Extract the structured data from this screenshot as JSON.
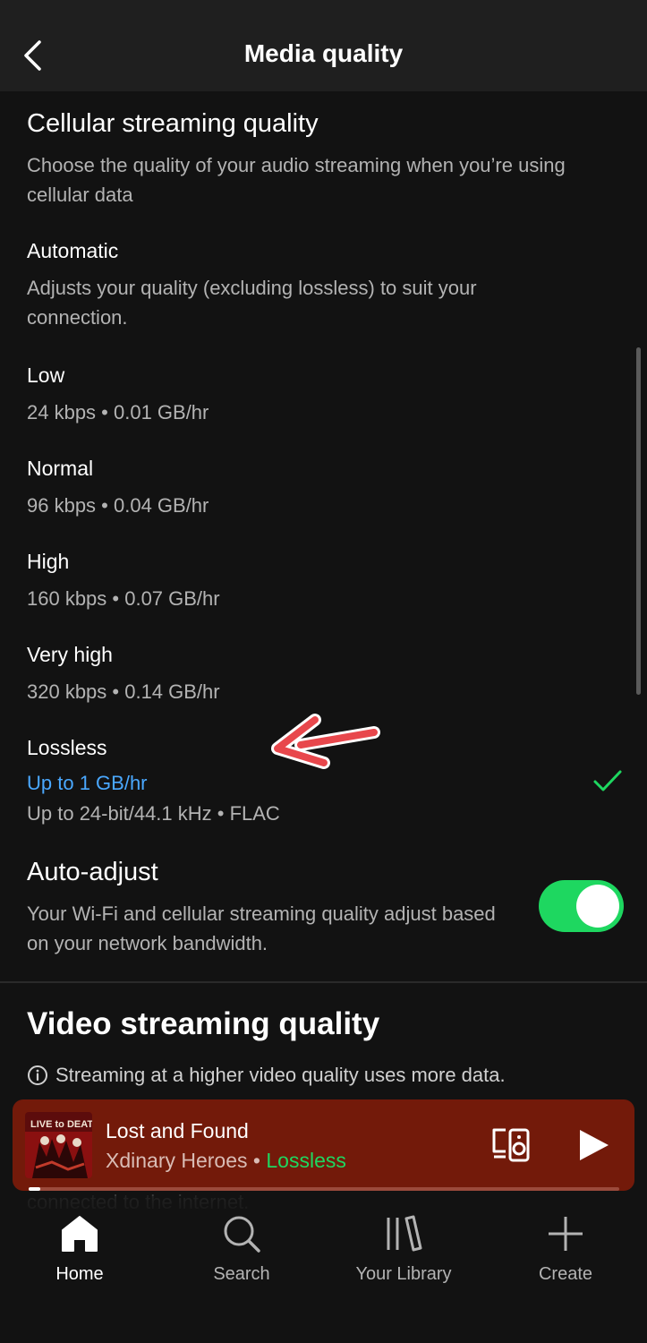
{
  "header": {
    "title": "Media quality"
  },
  "cellular": {
    "title": "Cellular streaming quality",
    "description": "Choose the quality of your audio streaming when you’re using cellular data"
  },
  "options": [
    {
      "label": "Automatic",
      "description": "Adjusts your quality (excluding lossless) to suit your connection."
    },
    {
      "label": "Low",
      "detail": "24 kbps • 0.01 GB/hr"
    },
    {
      "label": "Normal",
      "detail": "96 kbps • 0.04 GB/hr"
    },
    {
      "label": "High",
      "detail": "160 kbps • 0.07 GB/hr"
    },
    {
      "label": "Very high",
      "detail": "320 kbps • 0.14 GB/hr"
    },
    {
      "label": "Lossless",
      "accent": "Up to 1 GB/hr",
      "detail": "Up to 24-bit/44.1 kHz • FLAC",
      "selected": true
    }
  ],
  "auto_adjust": {
    "title": "Auto-adjust",
    "description": "Your Wi-Fi and cellular streaming quality adjust based on your network bandwidth.",
    "enabled": true
  },
  "video": {
    "title": "Video streaming quality",
    "info": "Streaming at a higher video quality uses more data.",
    "partial_text": "connected to the internet."
  },
  "player": {
    "title": "Lost and Found",
    "artist": "Xdinary Heroes",
    "separator": "•",
    "quality": "Lossless",
    "progress": 0.02
  },
  "nav": [
    {
      "label": "Home",
      "icon": "home-icon",
      "active": true
    },
    {
      "label": "Search",
      "icon": "search-icon",
      "active": false
    },
    {
      "label": "Your Library",
      "icon": "library-icon",
      "active": false
    },
    {
      "label": "Create",
      "icon": "plus-icon",
      "active": false
    }
  ],
  "colors": {
    "background": "#121212",
    "accent_green": "#1ed760",
    "accent_blue": "#4aa8ff",
    "player_bg": "#731a0a",
    "annotation_arrow": "#e8474c"
  }
}
